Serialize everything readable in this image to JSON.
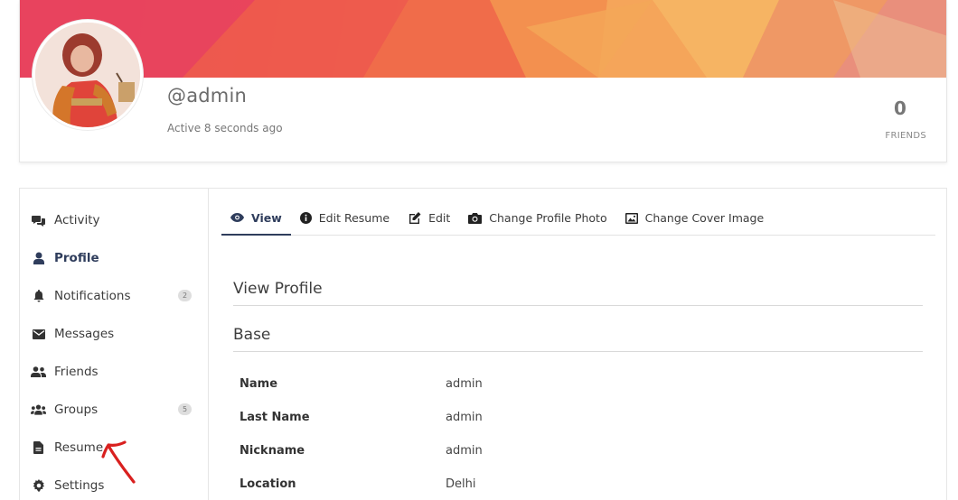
{
  "profile": {
    "username": "@admin",
    "active_status": "Active 8 seconds ago",
    "friends_count": "0",
    "friends_label": "FRIENDS"
  },
  "sidebar": {
    "items": [
      {
        "label": "Activity",
        "icon": "comments-icon"
      },
      {
        "label": "Profile",
        "icon": "user-icon",
        "active": true
      },
      {
        "label": "Notifications",
        "icon": "bell-icon",
        "badge": "2"
      },
      {
        "label": "Messages",
        "icon": "envelope-icon"
      },
      {
        "label": "Friends",
        "icon": "user-friends-icon"
      },
      {
        "label": "Groups",
        "icon": "users-icon",
        "badge": "5"
      },
      {
        "label": "Resume",
        "icon": "file-icon"
      },
      {
        "label": "Settings",
        "icon": "gear-icon"
      }
    ]
  },
  "tabs": [
    {
      "label": "View",
      "icon": "eye-icon",
      "active": true
    },
    {
      "label": "Edit Resume",
      "icon": "info-circle-icon"
    },
    {
      "label": "Edit",
      "icon": "edit-icon"
    },
    {
      "label": "Change Profile Photo",
      "icon": "camera-icon"
    },
    {
      "label": "Change Cover Image",
      "icon": "image-icon"
    }
  ],
  "main": {
    "page_heading": "View Profile",
    "section_heading": "Base",
    "fields": [
      {
        "label": "Name",
        "value": "admin"
      },
      {
        "label": "Last Name",
        "value": "admin"
      },
      {
        "label": "Nickname",
        "value": "admin"
      },
      {
        "label": "Location",
        "value": "Delhi"
      }
    ]
  },
  "colors": {
    "accent": "#2f3d5c",
    "annotation_arrow": "#d9201f"
  }
}
